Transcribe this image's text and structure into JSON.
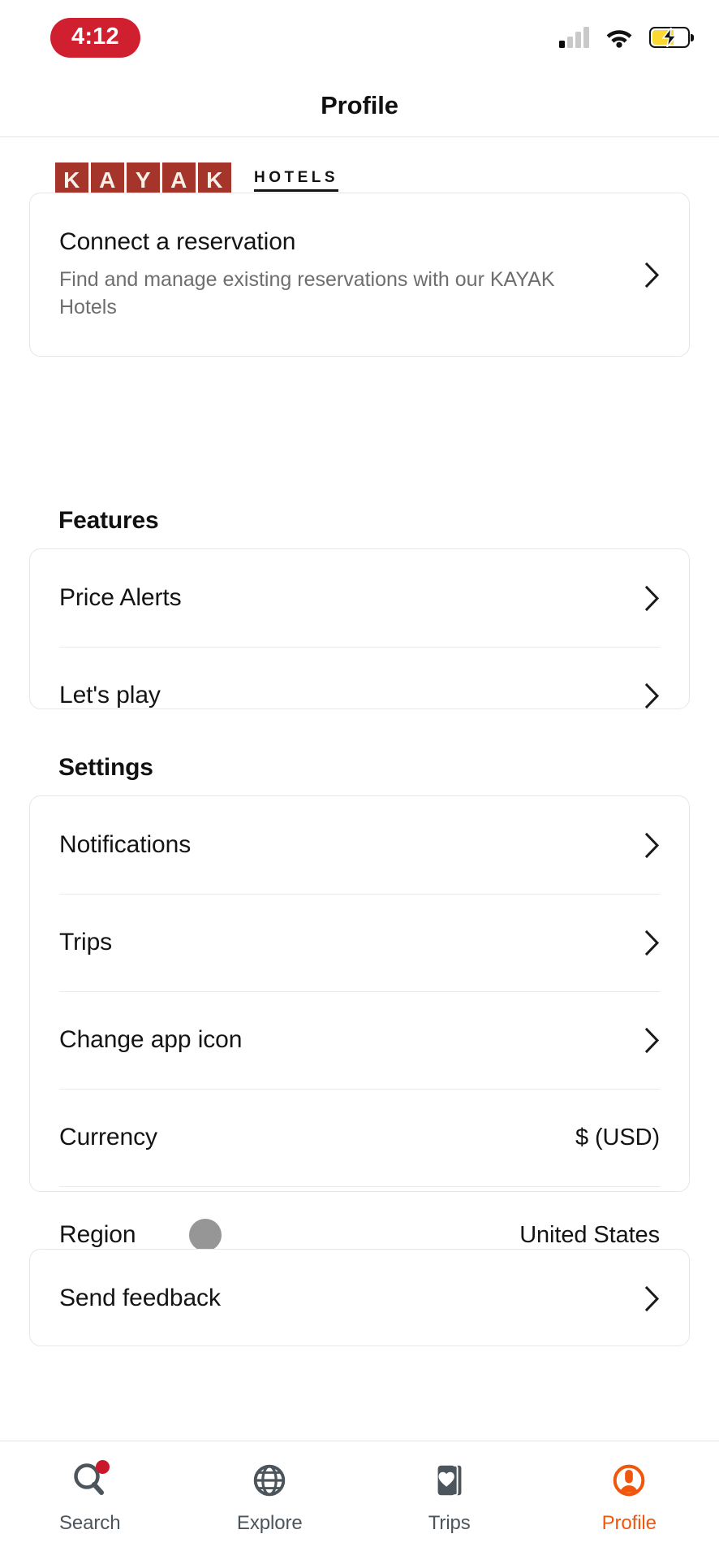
{
  "status_bar": {
    "time": "4:12",
    "time_pill_color": "#D0202F",
    "icons": [
      "cellular-signal-icon",
      "wifi-icon",
      "battery-charging-icon"
    ],
    "battery_fill_color": "#FBD832"
  },
  "header": {
    "title": "Profile"
  },
  "brand": {
    "tiles": [
      "K",
      "A",
      "Y",
      "A",
      "K"
    ],
    "tile_color": "#A5352A",
    "subtitle": "HOTELS"
  },
  "connect_card": {
    "title": "Connect a reservation",
    "subtitle": "Find and manage existing reservations with our KAYAK Hotels",
    "chevron": "chevron-right-icon"
  },
  "sections": [
    {
      "heading": "Features",
      "rows": [
        {
          "label": "Price Alerts",
          "value": "",
          "chevron": true
        },
        {
          "label": "Let's play",
          "value": "",
          "chevron": true
        }
      ]
    },
    {
      "heading": "Settings",
      "rows": [
        {
          "label": "Notifications",
          "value": "",
          "chevron": true
        },
        {
          "label": "Trips",
          "value": "",
          "chevron": true
        },
        {
          "label": "Change app icon",
          "value": "",
          "chevron": true
        },
        {
          "label": "Currency",
          "value": "$ (USD)",
          "chevron": false
        },
        {
          "label": "Region",
          "value": "United States",
          "chevron": false
        }
      ]
    },
    {
      "heading": "",
      "rows": [
        {
          "label": "Send feedback",
          "value": "",
          "chevron": true
        }
      ]
    }
  ],
  "tab_bar": {
    "active": "Profile",
    "active_color": "#F0560D",
    "inactive_color": "#4D555C",
    "items": [
      {
        "label": "Search",
        "icon": "search-icon",
        "badge": true
      },
      {
        "label": "Explore",
        "icon": "globe-icon",
        "badge": false
      },
      {
        "label": "Trips",
        "icon": "cards-heart-icon",
        "badge": false
      },
      {
        "label": "Profile",
        "icon": "account-circle-icon",
        "badge": false
      }
    ]
  }
}
